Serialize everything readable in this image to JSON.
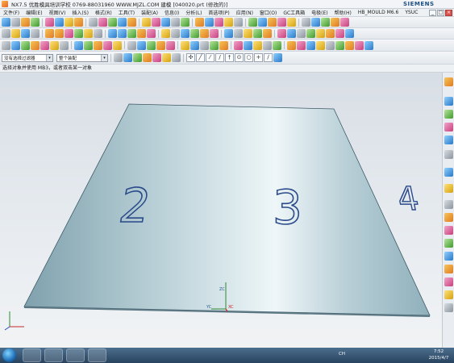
{
  "window": {
    "title": "NX7.5  优胜模具培训学校  0769-88031960  WWW.MJZL.COM  建模  [040020.prt  (修改的)]",
    "brand": "SIEMENS",
    "controls": [
      "_",
      "□",
      "×"
    ]
  },
  "menu": {
    "items": [
      "文件(F)",
      "编辑(E)",
      "视图(V)",
      "插入(S)",
      "格式(R)",
      "工具(T)",
      "装配(A)",
      "信息(I)",
      "分析(L)",
      "首选项(P)",
      "应用(N)",
      "窗口(O)",
      "GC工具箱",
      "电极(E)",
      "帮助(H)",
      "HB_MOULD M6.6",
      "YSUC"
    ]
  },
  "selection": {
    "filter_value": "没有选择过滤器",
    "scope_value": "整个装配"
  },
  "cue_line": "选择对象并使用 MB3，或者双击某一对象",
  "viewport": {
    "engraved_digits": [
      "2",
      "3",
      "4"
    ],
    "csys_labels": {
      "z": "ZC",
      "y": "YC",
      "x": "XC"
    },
    "colors": {
      "plate_face": "#a9c4cd",
      "plate_edge": "#3e5a65",
      "digit_outline": "#2a4a8a",
      "background_top": "#d8dee5",
      "background_bottom": "#f1f3f5"
    }
  },
  "taskbar": {
    "tray_text": "CH",
    "time": "7:52",
    "date": "2015/4/7"
  }
}
